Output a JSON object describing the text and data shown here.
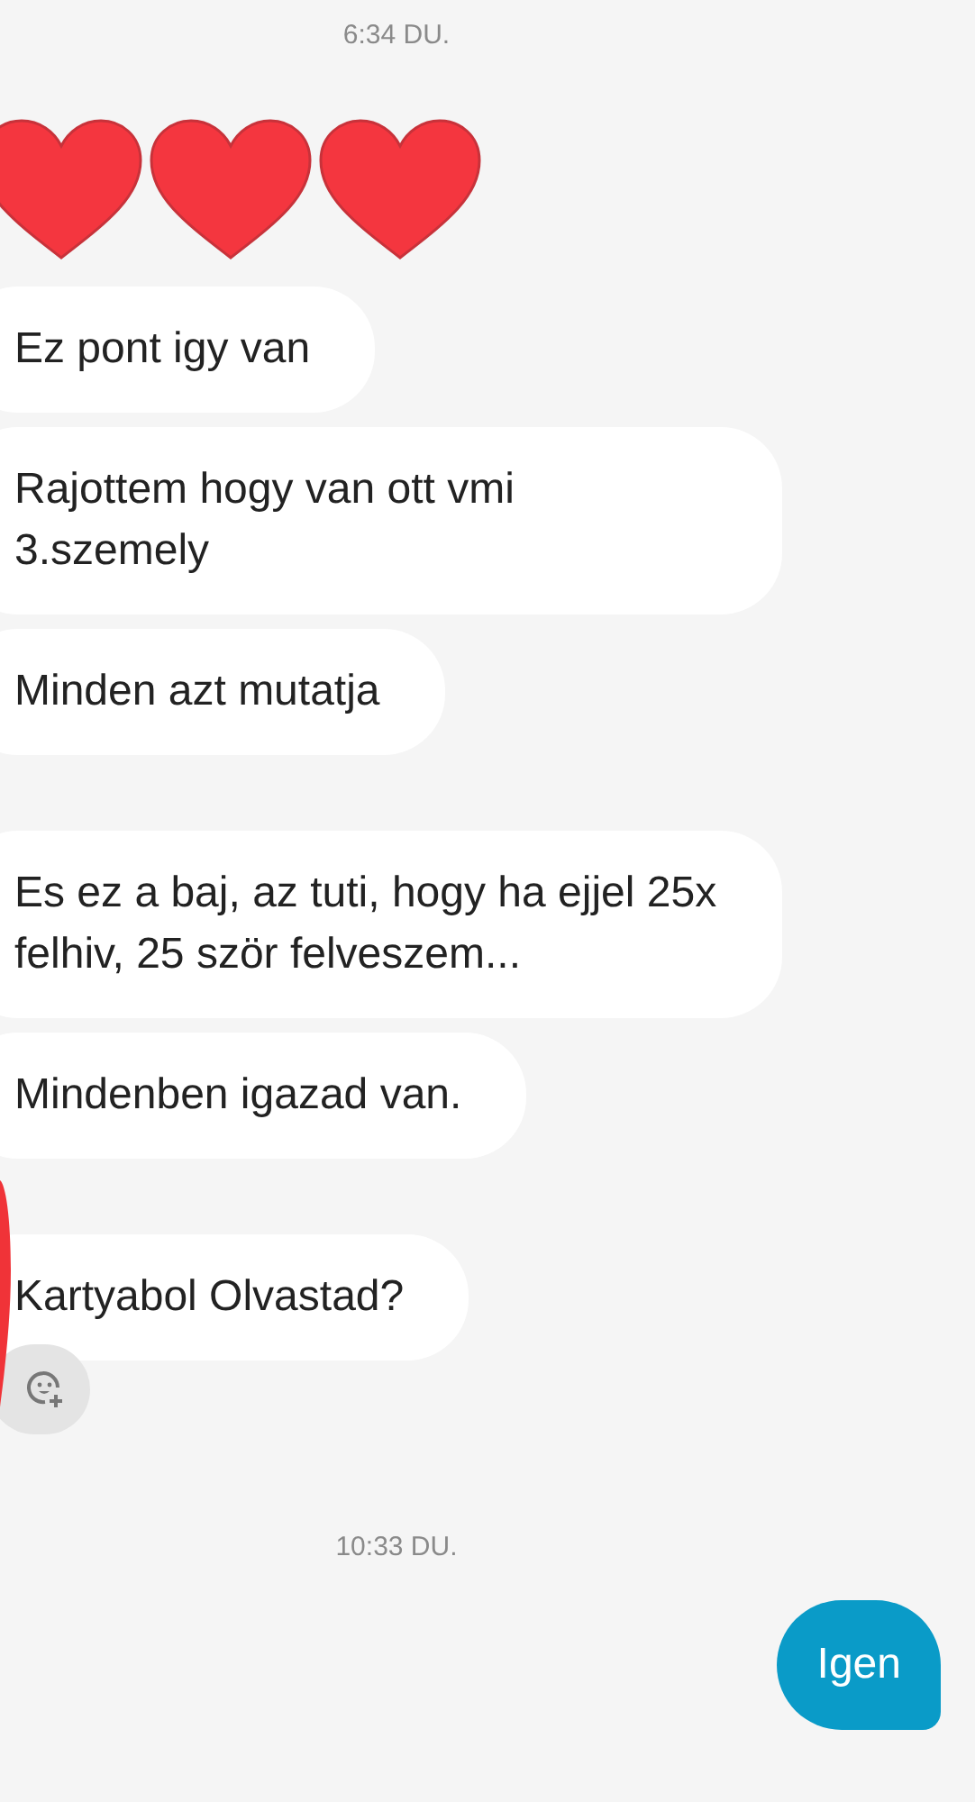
{
  "messages": [
    {
      "kind": "timestamp",
      "text": "6:34 DU."
    },
    {
      "kind": "hearts",
      "hearts": [
        {
          "kind": "heart"
        },
        {
          "kind": "heart"
        },
        {
          "kind": "heart"
        }
      ]
    },
    {
      "kind": "incoming",
      "text": "Ez pont igy van"
    },
    {
      "kind": "incoming",
      "text": "Rajottem hogy van ott vmi 3.szemely"
    },
    {
      "kind": "incoming",
      "text": "Minden azt mutatja"
    },
    {
      "kind": "gap"
    },
    {
      "kind": "incoming",
      "text": "Es ez a baj, az tuti, hogy ha ejjel 25x felhiv, 25 ször felveszem..."
    },
    {
      "kind": "incoming",
      "text": "Mindenben igazad van."
    },
    {
      "kind": "gap"
    },
    {
      "kind": "incoming",
      "text": "Kartyabol Olvastad?"
    },
    {
      "kind": "reaction"
    },
    {
      "kind": "timestamp",
      "text": "10:33 DU."
    },
    {
      "kind": "outgoing",
      "text": "Igen"
    }
  ]
}
